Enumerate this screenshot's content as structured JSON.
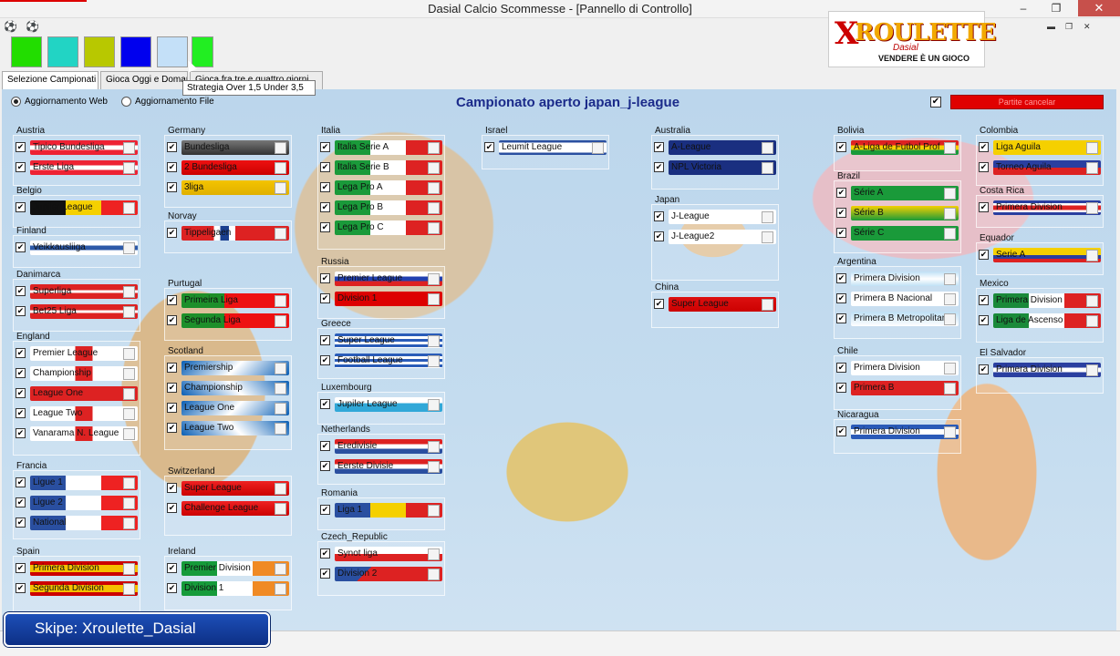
{
  "window": {
    "title": "Dasial Calcio Scommesse - [Pannello di Controllo]",
    "minimize": "–",
    "restore": "❐",
    "close": "✕"
  },
  "mdi": {
    "minimize": "▬",
    "restore": "❐",
    "close": "✕"
  },
  "balls": [
    "⚽",
    "⚽"
  ],
  "swatches": [
    "#22dd00",
    "#22d4c4",
    "#b8c800",
    "#0000ee",
    "#c4e0f8",
    "#22ee22"
  ],
  "logo": {
    "text": "ROULETTE",
    "x": "X",
    "sub": "Dasial",
    "tagline": "VENDERE È UN GIOCO"
  },
  "tabs": [
    {
      "label": "Selezione Campionati"
    },
    {
      "label": "Gioca Oggi e Domani"
    },
    {
      "label": "Gioca fra tre e quattro giorni"
    }
  ],
  "tooltip": "Strategia Over 1,5 Under 3,5",
  "radios": [
    {
      "label": "Aggiornamento Web",
      "checked": true
    },
    {
      "label": "Aggiornamento File",
      "checked": false
    }
  ],
  "heading": "Campionato aperto japan_j-league",
  "red_button": "Partite cancelar",
  "check": "✔",
  "groups": [
    {
      "name": "Austria",
      "leagues": [
        "Tipico Bundesliga",
        "Erste Liga"
      ]
    },
    {
      "name": "Belgio",
      "leagues": [
        "Jupiler League"
      ]
    },
    {
      "name": "Finland",
      "leagues": [
        "Veikkausliiga"
      ]
    },
    {
      "name": "Danimarca",
      "leagues": [
        "Superliga",
        "Bet25 Liga"
      ]
    },
    {
      "name": "England",
      "leagues": [
        "Premier League",
        "Championship",
        "League One",
        "League Two",
        "Vanarama N. League"
      ]
    },
    {
      "name": "Francia",
      "leagues": [
        "Ligue 1",
        "Ligue 2",
        "National"
      ]
    },
    {
      "name": "Spain",
      "leagues": [
        "Primera Division",
        "Segunda Division"
      ]
    },
    {
      "name": "Germany",
      "leagues": [
        "Bundesliga",
        "2 Bundesliga",
        "3liga"
      ]
    },
    {
      "name": "Norvay",
      "leagues": [
        "Tippeligaen"
      ]
    },
    {
      "name": "Purtugal",
      "leagues": [
        "Primeira Liga",
        "Segunda Liga"
      ]
    },
    {
      "name": "Scotland",
      "leagues": [
        "Premiership",
        "Championship",
        "League One",
        "League Two"
      ]
    },
    {
      "name": "Switzerland",
      "leagues": [
        "Super League",
        "Challenge League"
      ]
    },
    {
      "name": "Ireland",
      "leagues": [
        "Premier Division",
        "Division 1"
      ]
    },
    {
      "name": "Italia",
      "leagues": [
        "Italia Serie A",
        "Italia Serie B",
        "Lega Pro A",
        "Lega Pro B",
        "Lega Pro C"
      ]
    },
    {
      "name": "Russia",
      "leagues": [
        "Premier League",
        "Division 1"
      ]
    },
    {
      "name": "Greece",
      "leagues": [
        "Super League",
        "Football League"
      ]
    },
    {
      "name": "Luxembourg",
      "leagues": [
        "Jupiler League"
      ]
    },
    {
      "name": "Netherlands",
      "leagues": [
        "Eredivisie",
        "Eerste Divisie"
      ]
    },
    {
      "name": "Romania",
      "leagues": [
        "Liga 1"
      ]
    },
    {
      "name": "Czech_Republic",
      "leagues": [
        "Synot liga",
        "Division 2"
      ]
    },
    {
      "name": "Israel",
      "leagues": [
        "Leumit League"
      ]
    },
    {
      "name": "Australia",
      "leagues": [
        "A-League",
        "NPL Victoria"
      ]
    },
    {
      "name": "Japan",
      "leagues": [
        "J-League",
        "J-League2"
      ]
    },
    {
      "name": "China",
      "leagues": [
        "Super League"
      ]
    },
    {
      "name": "Bolivia",
      "leagues": [
        "A-Liga de Futbol Prof"
      ]
    },
    {
      "name": "Brazil",
      "leagues": [
        "Série A",
        "Série B",
        "Série C"
      ]
    },
    {
      "name": "Argentina",
      "leagues": [
        "Primera Division",
        "Primera B Nacional",
        "Primera B Metropolitan"
      ]
    },
    {
      "name": "Chile",
      "leagues": [
        "Primera Division",
        "Primera B"
      ]
    },
    {
      "name": "Nicaragua",
      "leagues": [
        "Primera Division"
      ]
    },
    {
      "name": "Colombia",
      "leagues": [
        "Liga Aguila",
        "Torneo Aguila"
      ]
    },
    {
      "name": "Costa Rica",
      "leagues": [
        "Primera Division"
      ]
    },
    {
      "name": "Equador",
      "leagues": [
        "Serie A"
      ]
    },
    {
      "name": "Mexico",
      "leagues": [
        "Primera Division",
        "Liga de Ascenso"
      ]
    },
    {
      "name": "El Salvador",
      "leagues": [
        "Primera Division"
      ]
    }
  ],
  "skype": "Skipe: Xroulette_Dasial"
}
